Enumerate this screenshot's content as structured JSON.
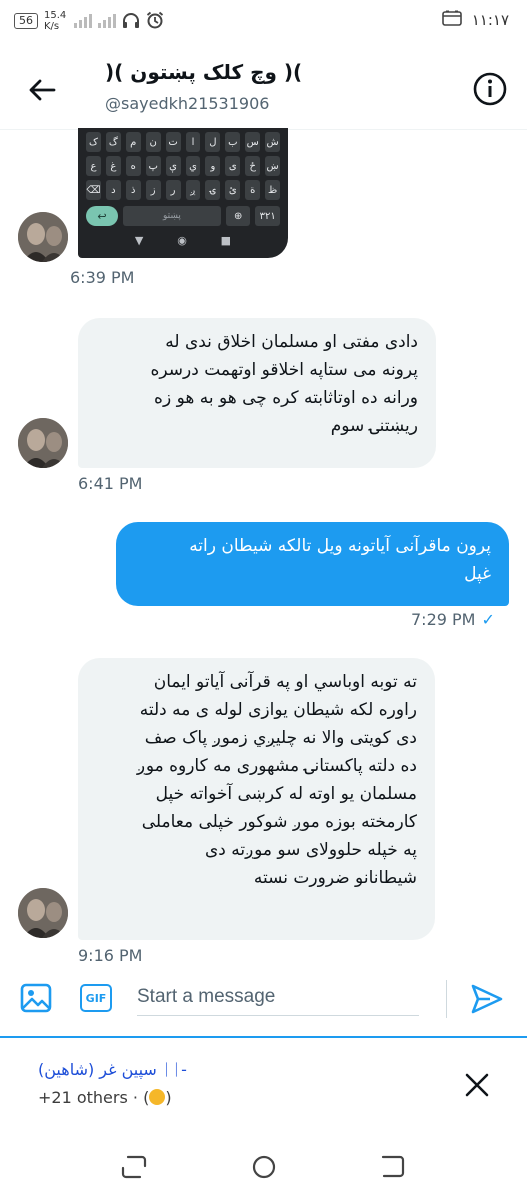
{
  "status_bar": {
    "network_badge": "56",
    "speed_value": "15.4",
    "speed_unit": "K/s",
    "signal_label": "3G",
    "time": "١١:١٧"
  },
  "header": {
    "title": ")( وچ کلک پښتون )(",
    "handle": "@sayedkh21531906"
  },
  "messages": [
    {
      "type": "image",
      "direction": "in",
      "time": "6:39 PM"
    },
    {
      "type": "text",
      "direction": "in",
      "time": "6:41 PM",
      "lines": [
        "دادی مفتی او مسلمان اخلاق ندی له",
        "پرونه می ستاپه اخلاقو اوتهمت درسره",
        "ورانه ده اوتاثابته کره  چی هو به هو زه",
        "ريښتنۍ سوم"
      ]
    },
    {
      "type": "text",
      "direction": "out",
      "time": "7:29 PM",
      "lines": [
        "پرون ماقرآنی آیاتونه ویل تالکه شیطان راته",
        "غپل"
      ]
    },
    {
      "type": "text",
      "direction": "in",
      "time": "9:16 PM",
      "lines": [
        "ته توبه اوباسي او په قرآنی آیاتو ایمان",
        "راوره لکه شیطان یوازی لوله ی مه دلته",
        "دی کويتی والا نه چلیږي  زموږ پاک صف",
        "ده دلته پاکستانۍ مشهوری مه کاروه  موږ",
        "مسلمان یو اوته له کرښی آخواته خپل",
        "کارمخته بوزه موږ شوکور خپلی معاملی",
        "په خپله حلوولای سو  موږته دی",
        "شيطانانو ضرورت نسته"
      ]
    }
  ],
  "keyboard": {
    "row1": [
      "ک",
      "گ",
      "م",
      "ن",
      "ت",
      "ا",
      "ل",
      "ب",
      "س",
      "ش"
    ],
    "row2": [
      "ع",
      "غ",
      "ه",
      "پ",
      "ې",
      "ي",
      "و",
      "ی",
      "ځ",
      "ښ"
    ],
    "row3": [
      "د",
      "ذ",
      "ز",
      "ر",
      "ږ",
      "ۍ",
      "ئ",
      "ة",
      "ظ"
    ],
    "space": "پښتو",
    "num": "٣٢١"
  },
  "composer": {
    "placeholder": "Start a message",
    "gif_label": "GIF"
  },
  "notification": {
    "name": "سپین غر (شاهین) ᛁᛁ-",
    "others": "+21 others · ("
  },
  "colors": {
    "accent": "#1d9bf0",
    "incoming_bubble": "#eff3f4",
    "text_secondary": "#536471"
  }
}
